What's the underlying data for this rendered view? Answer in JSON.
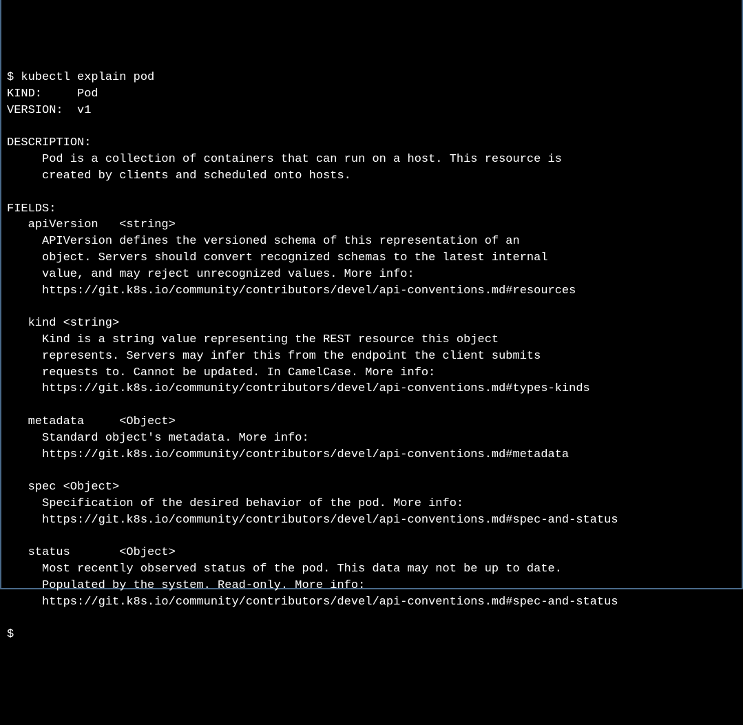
{
  "prompt1": "$ ",
  "command": "kubectl explain pod",
  "kind_label": "KIND:     ",
  "kind_value": "Pod",
  "version_label": "VERSION:  ",
  "version_value": "v1",
  "blank": "",
  "description_header": "DESCRIPTION:",
  "description_line1": "Pod is a collection of containers that can run on a host. This resource is",
  "description_line2": "created by clients and scheduled onto hosts.",
  "fields_header": "FIELDS:",
  "fields": {
    "apiVersion": {
      "name": "apiVersion   <string>",
      "desc1": "APIVersion defines the versioned schema of this representation of an",
      "desc2": "object. Servers should convert recognized schemas to the latest internal",
      "desc3": "value, and may reject unrecognized values. More info:",
      "desc4": "https://git.k8s.io/community/contributors/devel/api-conventions.md#resources"
    },
    "kind": {
      "name": "kind <string>",
      "desc1": "Kind is a string value representing the REST resource this object",
      "desc2": "represents. Servers may infer this from the endpoint the client submits",
      "desc3": "requests to. Cannot be updated. In CamelCase. More info:",
      "desc4": "https://git.k8s.io/community/contributors/devel/api-conventions.md#types-kinds"
    },
    "metadata": {
      "name": "metadata     <Object>",
      "desc1": "Standard object's metadata. More info:",
      "desc2": "https://git.k8s.io/community/contributors/devel/api-conventions.md#metadata"
    },
    "spec": {
      "name": "spec <Object>",
      "desc1": "Specification of the desired behavior of the pod. More info:",
      "desc2": "https://git.k8s.io/community/contributors/devel/api-conventions.md#spec-and-status"
    },
    "status": {
      "name": "status       <Object>",
      "desc1": "Most recently observed status of the pod. This data may not be up to date.",
      "desc2": "Populated by the system. Read-only. More info:",
      "desc3": "https://git.k8s.io/community/contributors/devel/api-conventions.md#spec-and-status"
    }
  },
  "prompt2": "$"
}
